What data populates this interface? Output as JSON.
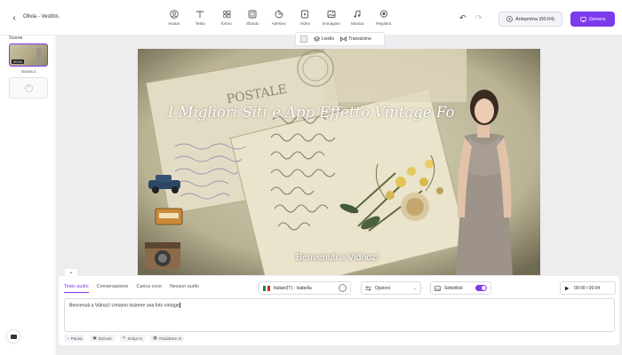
{
  "topbar": {
    "project_name": "Olivia - Vestito",
    "tools": [
      {
        "icon": "avatar-icon",
        "label": "Avatar"
      },
      {
        "icon": "text-icon",
        "label": "Testo"
      },
      {
        "icon": "shapes-icon",
        "label": "forma"
      },
      {
        "icon": "background-icon",
        "label": "Sfondo"
      },
      {
        "icon": "sticker-icon",
        "label": "Adesivo"
      },
      {
        "icon": "video-icon",
        "label": "Video"
      },
      {
        "icon": "image-icon",
        "label": "Immagine"
      },
      {
        "icon": "music-icon",
        "label": "Musica"
      },
      {
        "icon": "recording-icon",
        "label": "Registra"
      }
    ],
    "preview_label": "Anteprima (00:04)",
    "generate_label": "Genera"
  },
  "scenes": {
    "title": "Scene",
    "items": [
      {
        "label": "Scena 1",
        "duration": "00:04"
      }
    ]
  },
  "canvas": {
    "layer_label": "Livello",
    "transition_label": "Transizione",
    "postcard_stamp_text": "POSTALE",
    "title": "I Migliori Siti e App Effetto Vintage Fo",
    "subtitle": "Benvenuti a Vidnoz!"
  },
  "audio_panel": {
    "tabs": [
      {
        "label": "Testo audio",
        "active": true
      },
      {
        "label": "Conversazione",
        "active": false
      },
      {
        "label": "Carica voce",
        "active": false
      },
      {
        "label": "Nessun audio",
        "active": false
      }
    ],
    "voice": "Italian(IT) - Isabella",
    "options_label": "Opzioni",
    "subtitles_label": "Sottotitoli",
    "subtitles_on": true,
    "time": "00:00 / 00:04",
    "script_text": "Benvenuti a Vidnoz! creiamo insieme una foto vintage",
    "actions": [
      {
        "icon": "pause-icon",
        "label": "Pausa"
      },
      {
        "icon": "diction-icon",
        "label": "Dizione"
      },
      {
        "icon": "ai-script-icon",
        "label": "Script AI"
      },
      {
        "icon": "translate-icon",
        "label": "Traduttore AI"
      }
    ]
  },
  "colors": {
    "accent": "#7c3aed",
    "canvas_bg": "#bdb89c",
    "workspace_bg": "#ededf0"
  }
}
